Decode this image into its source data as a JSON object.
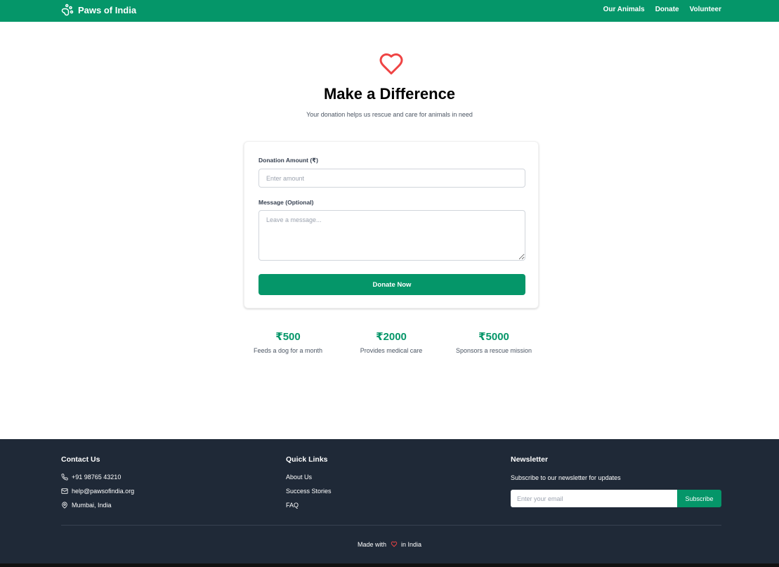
{
  "header": {
    "brand": "Paws of India",
    "nav": [
      "Our Animals",
      "Donate",
      "Volunteer"
    ],
    "bg_color": "#059669"
  },
  "hero": {
    "icon": "heart-icon",
    "title": "Make a Difference",
    "subtitle": "Your donation helps us rescue and care for animals in need"
  },
  "form": {
    "amount_label": "Donation Amount (₹)",
    "amount_placeholder": "Enter amount",
    "message_label": "Message (Optional)",
    "message_placeholder": "Leave a message...",
    "submit_label": "Donate Now"
  },
  "tiers": [
    {
      "amount": "₹500",
      "description": "Feeds a dog for a month"
    },
    {
      "amount": "₹2000",
      "description": "Provides medical care"
    },
    {
      "amount": "₹5000",
      "description": "Sponsors a rescue mission"
    }
  ],
  "footer": {
    "contact_title": "Contact Us",
    "phone": "+91 98765 43210",
    "email": "help@pawsofindia.org",
    "location": "Mumbai, India",
    "links_title": "Quick Links",
    "links": [
      "About Us",
      "Success Stories",
      "FAQ"
    ],
    "newsletter_title": "Newsletter",
    "newsletter_text": "Subscribe to our newsletter for updates",
    "newsletter_placeholder": "Enter your email",
    "subscribe_label": "Subscribe",
    "made_prefix": "Made with",
    "made_suffix": "in India",
    "bg_color": "#1f2937"
  },
  "colors": {
    "accent": "#059669",
    "heart": "#ef4444"
  }
}
